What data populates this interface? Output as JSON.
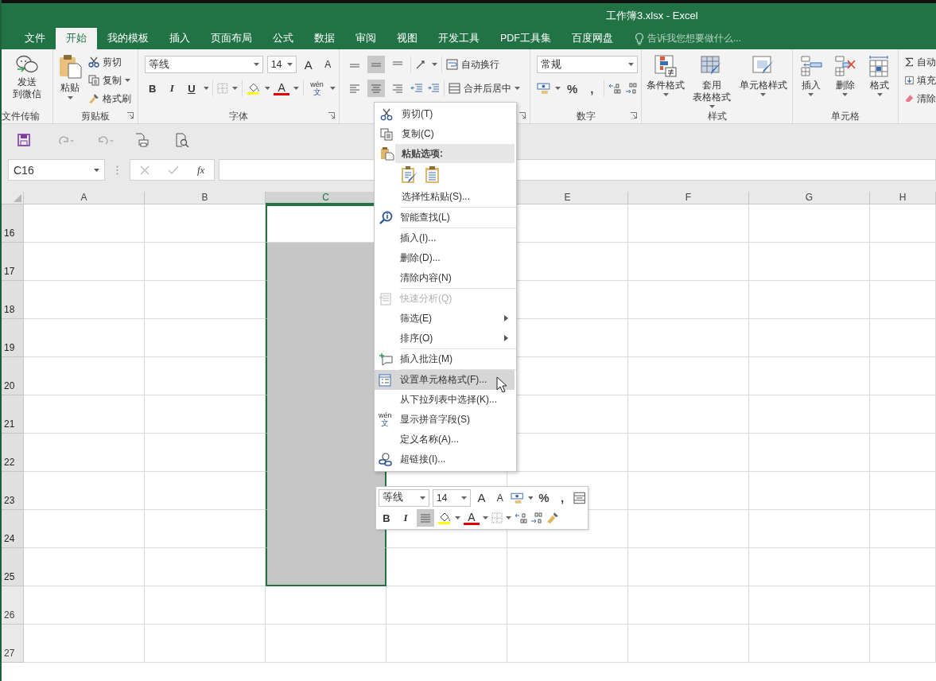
{
  "window": {
    "title": "工作簿3.xlsx - Excel"
  },
  "tabs": [
    {
      "label": "文件",
      "selected": false
    },
    {
      "label": "开始",
      "selected": true
    },
    {
      "label": "我的模板",
      "selected": false
    },
    {
      "label": "插入",
      "selected": false
    },
    {
      "label": "页面布局",
      "selected": false
    },
    {
      "label": "公式",
      "selected": false
    },
    {
      "label": "数据",
      "selected": false
    },
    {
      "label": "审阅",
      "selected": false
    },
    {
      "label": "视图",
      "selected": false
    },
    {
      "label": "开发工具",
      "selected": false
    },
    {
      "label": "PDF工具集",
      "selected": false
    },
    {
      "label": "百度网盘",
      "selected": false
    }
  ],
  "tell_me": {
    "placeholder": "告诉我您想要做什么..."
  },
  "ribbon": {
    "file_transfer": {
      "label": "文件传输",
      "button": [
        "发送",
        "到微信"
      ]
    },
    "clipboard": {
      "label": "剪贴板",
      "paste": "粘贴",
      "items": [
        "剪切",
        "复制",
        "格式刷"
      ]
    },
    "font": {
      "label": "字体",
      "font_name": "等线",
      "font_size": "14",
      "grow": "A",
      "shrink": "A",
      "styles": [
        "B",
        "I",
        "U"
      ],
      "font_color": "A",
      "phonetic_top": "wén",
      "phonetic_bottom": "文"
    },
    "alignment": {
      "top_row": [
        {
          "selected": false
        },
        {
          "selected": true
        },
        {
          "selected": false
        }
      ],
      "bottom_row": [
        {
          "selected": false
        },
        {
          "selected": true
        },
        {
          "selected": false
        }
      ],
      "wrap": "自动换行",
      "merge": "合并后居中"
    },
    "number": {
      "label": "数字",
      "format": "常规",
      "percent": "%",
      "comma": ","
    },
    "styles": {
      "label": "样式",
      "items": [
        [
          "条件格式"
        ],
        [
          "套用",
          "表格格式"
        ],
        [
          "单元格样式"
        ]
      ]
    },
    "cells": {
      "label": "单元格",
      "items": [
        "插入",
        "删除",
        "格式"
      ]
    },
    "editing": {
      "items": [
        "自动",
        "填充",
        "清除"
      ]
    }
  },
  "formula_bar": {
    "name_box": "C16",
    "fx": "fx"
  },
  "sheet": {
    "columns": [
      {
        "label": "A",
        "selected": false
      },
      {
        "label": "B",
        "selected": false
      },
      {
        "label": "C",
        "selected": true
      },
      {
        "selected": false
      },
      {
        "label": "E",
        "selected": false
      },
      {
        "label": "F",
        "selected": false
      },
      {
        "label": "G",
        "selected": false
      },
      {
        "label": "H",
        "selected": false
      }
    ],
    "rows": [
      {
        "label": "16",
        "selected": true,
        "active": true
      },
      {
        "label": "17",
        "selected": true,
        "active": false
      },
      {
        "label": "18",
        "selected": true,
        "active": false
      },
      {
        "label": "19",
        "selected": true,
        "active": false
      },
      {
        "label": "20",
        "selected": true,
        "active": false
      },
      {
        "label": "21",
        "selected": true,
        "active": false
      },
      {
        "label": "22",
        "selected": true,
        "active": false
      },
      {
        "label": "23",
        "selected": true,
        "active": false
      },
      {
        "label": "24",
        "selected": true,
        "active": false
      },
      {
        "label": "25",
        "selected": true,
        "active": false
      },
      {
        "label": "26",
        "selected": false,
        "active": false
      },
      {
        "label": "27",
        "selected": false,
        "active": false
      }
    ]
  },
  "context_menu": {
    "groups": [
      [
        {
          "kind": "item",
          "label": "剪切(T)",
          "disabled": false,
          "submenu": false,
          "selected": false
        },
        {
          "kind": "item",
          "label": "复制(C)",
          "disabled": false,
          "submenu": false,
          "selected": false
        },
        {
          "kind": "header",
          "label": "粘贴选项:"
        },
        {
          "kind": "paste_options"
        },
        {
          "kind": "item",
          "label": "选择性粘贴(S)...",
          "disabled": false,
          "submenu": false,
          "selected": false
        }
      ],
      [
        {
          "kind": "item",
          "label": "智能查找(L)",
          "disabled": false,
          "submenu": false,
          "selected": false
        }
      ],
      [
        {
          "kind": "item",
          "label": "插入(I)...",
          "disabled": false,
          "submenu": false,
          "selected": false
        },
        {
          "kind": "item",
          "label": "删除(D)...",
          "disabled": false,
          "submenu": false,
          "selected": false
        },
        {
          "kind": "item",
          "label": "清除内容(N)",
          "disabled": false,
          "submenu": false,
          "selected": false
        }
      ],
      [
        {
          "kind": "item",
          "label": "快速分析(Q)",
          "disabled": true,
          "submenu": false,
          "selected": false
        },
        {
          "kind": "item",
          "label": "筛选(E)",
          "disabled": false,
          "submenu": true,
          "selected": false
        },
        {
          "kind": "item",
          "label": "排序(O)",
          "disabled": false,
          "submenu": true,
          "selected": false
        }
      ],
      [
        {
          "kind": "item",
          "label": "插入批注(M)",
          "disabled": false,
          "submenu": false,
          "selected": false
        }
      ],
      [
        {
          "kind": "item",
          "label": "设置单元格格式(F)...",
          "disabled": false,
          "submenu": false,
          "selected": true
        },
        {
          "kind": "item",
          "label": "从下拉列表中选择(K)...",
          "disabled": false,
          "submenu": false,
          "selected": false
        },
        {
          "kind": "item",
          "label": "显示拼音字段(S)",
          "disabled": false,
          "submenu": false,
          "selected": false,
          "phonetic_top": "wén",
          "phonetic_bottom": "文"
        },
        {
          "kind": "item",
          "label": "定义名称(A)...",
          "disabled": false,
          "submenu": false,
          "selected": false
        },
        {
          "kind": "item",
          "label": "超链接(I)...",
          "disabled": false,
          "submenu": false,
          "selected": false
        }
      ]
    ]
  },
  "mini_toolbar": {
    "font_name": "等线",
    "font_size": "14",
    "grow": "A",
    "shrink": "A",
    "percent": "%",
    "comma": ",",
    "styles": [
      "B",
      "I"
    ],
    "center_selected": true,
    "font_color": "A"
  }
}
